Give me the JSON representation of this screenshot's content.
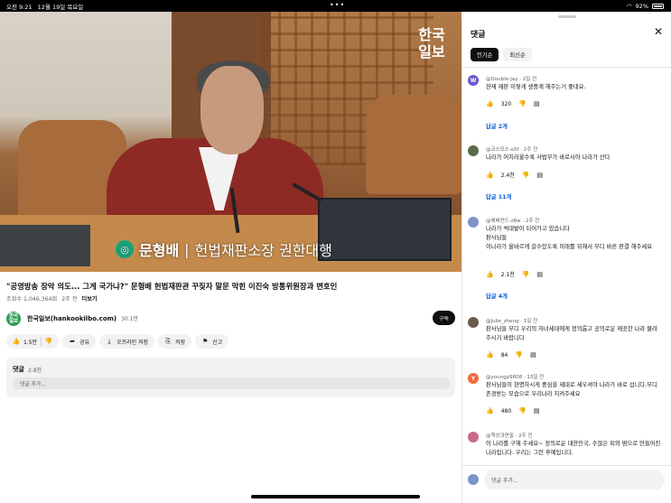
{
  "status": {
    "time": "오전 9:21",
    "date": "12월 19일 목요일",
    "battery": "92%"
  },
  "video": {
    "logo_line1": "한국",
    "logo_line2": "일보",
    "caption_name": "문형배",
    "caption_sep": "|",
    "caption_title": "헌법재판소장 권한대행"
  },
  "info": {
    "title": "\"공영방송 장악 의도... 그게 국가냐?\" 문형배 헌법재판관 꾸짖자 말문 막힌 이진숙 방통위원장과 변호인",
    "views": "조회수 1,046,364회",
    "age": "2주 전",
    "more": "더보기",
    "channel_name": "한국일보(hankookilbo.com)",
    "channel_subs": "30.1만",
    "channel_avatar_line1": "한국",
    "channel_avatar_line2": "일보",
    "subscribe": "구독"
  },
  "actions": {
    "likes": "1.5만",
    "share": "공유",
    "offline": "오프라인 저장",
    "save": "저장",
    "report": "신고"
  },
  "comment_box": {
    "title": "댓글",
    "count": "2.8천",
    "placeholder": "댓글 추가..."
  },
  "panel": {
    "title": "댓글",
    "chip_popular": "인기순",
    "chip_latest": "최신순",
    "comments": [
      {
        "avatar": "W",
        "color": "#6a5acd",
        "handle": "@Double-Jay",
        "age": "2일 전",
        "text": "헌재 재판 이렇게 생중계 해주는거 좋네요.",
        "likes": "320",
        "replies": "답글 2개"
      },
      {
        "avatar": "",
        "color": "#5a6b4a",
        "handle": "@코스모스-o5f",
        "age": "2주 전",
        "text": "나라가 어지러울수록 사법부가 바로서야 나라가 산다",
        "likes": "2.4천",
        "replies": "답글 11개"
      },
      {
        "avatar": "",
        "color": "#7d95c9",
        "handle": "@예배찬드-z8w",
        "age": "2주 전",
        "text": "나라가 씩대밭이 되어가고 있습니다\n판사님들\n이나라가 올바르게 갈수있도록 미래를 위해서 부디 바른 판결 해주세요",
        "likes": "2.1천",
        "replies": "답글 4개"
      },
      {
        "avatar": "",
        "color": "#6b5b4b",
        "handle": "@Julie_zheng",
        "age": "1일 전",
        "text": "판사님들 부디 우리의 자녀세대에게 정의롭고 공의로운 깨끗한 나라 물려 주시기 바랍니다",
        "likes": "84",
        "replies": ""
      },
      {
        "avatar": "Y",
        "color": "#f06a3a",
        "handle": "@youngp9808",
        "age": "13일 전",
        "text": "판사님들이 현명하시게 중심을 제대로 세우셔야 나라가 바로 섭니다.부디 존경받는 모습으로 우리나라 지켜주세요",
        "likes": "480",
        "replies": ""
      },
      {
        "avatar": "",
        "color": "#c96a8a",
        "handle": "@책상과연필",
        "age": "2주 전",
        "text": "이 나라를 구해 주세요~ 정의로운 대한민국, 수많은 피와 땀으로 만들어진 나라입니다. 우리는 그런 후예입니다.",
        "likes": "",
        "replies": ""
      }
    ],
    "input_placeholder": "댓글 추가..."
  },
  "icons": {
    "like": "thumbs-up-icon",
    "dislike": "thumbs-down-icon",
    "reply": "comment-icon",
    "close": "close-icon"
  }
}
